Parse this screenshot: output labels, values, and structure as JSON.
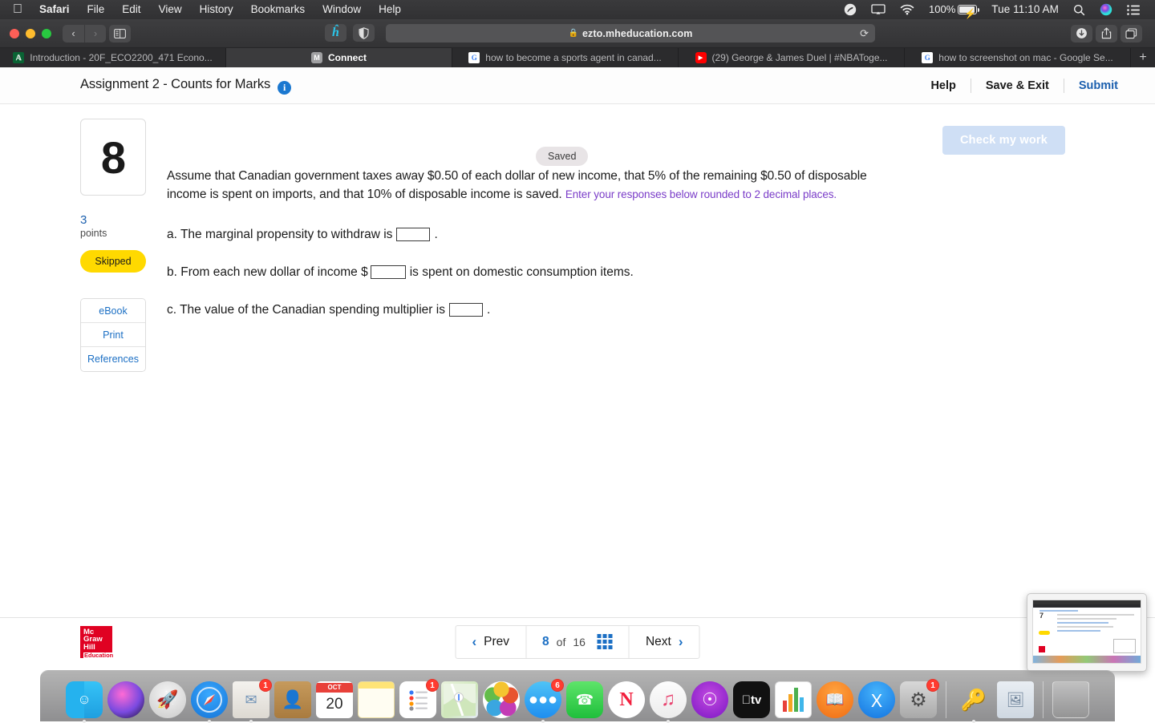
{
  "menubar": {
    "apple_icon": "apple-logo",
    "items": [
      {
        "label": "Safari",
        "bold": true
      },
      {
        "label": "File",
        "bold": false
      },
      {
        "label": "Edit",
        "bold": false
      },
      {
        "label": "View",
        "bold": false
      },
      {
        "label": "History",
        "bold": false
      },
      {
        "label": "Bookmarks",
        "bold": false
      },
      {
        "label": "Window",
        "bold": false
      },
      {
        "label": "Help",
        "bold": false
      }
    ],
    "status": {
      "shazam_icon": "shazam-icon",
      "airplay_icon": "airplay-icon",
      "wifi_icon": "wifi-icon",
      "battery_percent": "100%",
      "battery_icon": "battery-charging-icon",
      "clock": "Tue 11:10 AM",
      "search_icon": "spotlight-search-icon",
      "siri_icon": "siri-icon",
      "control_center_icon": "control-center-icon"
    }
  },
  "browser": {
    "toolbar": {
      "back_icon": "back-chevron-icon",
      "forward_icon": "forward-chevron-icon",
      "sidebar_icon": "sidebar-toggle-icon",
      "honey_icon": "honey-extension-icon",
      "privacy_icon": "privacy-report-icon",
      "downloads_icon": "downloads-icon",
      "share_icon": "share-icon",
      "tabs_icon": "tab-overview-icon"
    },
    "address": {
      "lock_icon": "lock-icon",
      "url": "ezto.mheducation.com",
      "reload_icon": "reload-icon"
    },
    "tabs": [
      {
        "favicon": "acorn-icon",
        "label": "Introduction - 20F_ECO2200_471 Econo...",
        "active": false
      },
      {
        "favicon": "mcgraw-m-icon",
        "label": "Connect",
        "active": true
      },
      {
        "favicon": "google-icon",
        "label": "how to become a sports agent in canad...",
        "active": false
      },
      {
        "favicon": "youtube-icon",
        "label": "(29) George & James Duel | #NBAToge...",
        "active": false
      },
      {
        "favicon": "google-icon",
        "label": "how to screenshot on mac - Google Se...",
        "active": false
      }
    ],
    "new_tab_label": "+"
  },
  "page": {
    "header": {
      "title": "Assignment 2 - Counts for Marks",
      "info_icon": "info-icon",
      "status_badge": "Saved",
      "actions": [
        {
          "label": "Help",
          "style": "plain"
        },
        {
          "label": "Save & Exit",
          "style": "plain"
        },
        {
          "label": "Submit",
          "style": "link"
        }
      ]
    },
    "rail": {
      "question_number": "8",
      "points_value": "3",
      "points_label": "points",
      "status_badge": "Skipped",
      "status_color": "#ffd900",
      "tools": [
        {
          "label": "eBook"
        },
        {
          "label": "Print"
        },
        {
          "label": "References"
        }
      ]
    },
    "check_my_work": "Check my work",
    "question": {
      "body": "Assume that Canadian government taxes away $0.50 of each dollar of new income, that 5% of the remaining $0.50 of disposable income is spent on imports, and that 10% of disposable income is saved.",
      "hint": "Enter your responses below rounded to 2 decimal places.",
      "hint_color": "#7a3cc8",
      "parts": [
        {
          "before": "a. The marginal propensity to withdraw is",
          "value": "",
          "after": "."
        },
        {
          "before": "b. From each new dollar of income $",
          "value": "",
          "after": "is spent on domestic consumption items."
        },
        {
          "before": "c. The value of the Canadian spending multiplier is",
          "value": "",
          "after": "."
        }
      ]
    },
    "footer": {
      "logo_lines": [
        "Mc",
        "Graw",
        "Hill"
      ],
      "logo_sub": "Education",
      "prev_label": "Prev",
      "prev_icon": "chevron-left-icon",
      "current_page": "8",
      "of_label": "of",
      "total_pages": "16",
      "grid_icon": "question-grid-icon",
      "next_label": "Next",
      "next_icon": "chevron-right-icon"
    }
  },
  "screenshot_preview": {
    "name": "screenshot-thumbnail",
    "question_number": "7"
  },
  "dock": {
    "apps": [
      {
        "name": "finder",
        "icon": "finder-icon",
        "badge": "",
        "running": true
      },
      {
        "name": "siri",
        "icon": "siri-icon",
        "badge": "",
        "running": false
      },
      {
        "name": "launchpad",
        "icon": "launchpad-icon",
        "badge": "",
        "running": false
      },
      {
        "name": "safari",
        "icon": "safari-icon",
        "badge": "",
        "running": true
      },
      {
        "name": "mail",
        "icon": "mail-icon",
        "badge": "1",
        "running": true
      },
      {
        "name": "contacts",
        "icon": "contacts-icon",
        "badge": "",
        "running": false
      },
      {
        "name": "calendar",
        "icon": "calendar-icon",
        "badge": "",
        "running": false,
        "month": "OCT",
        "day": "20"
      },
      {
        "name": "notes",
        "icon": "notes-icon",
        "badge": "",
        "running": false
      },
      {
        "name": "reminders",
        "icon": "reminders-icon",
        "badge": "1",
        "running": false
      },
      {
        "name": "maps",
        "icon": "maps-icon",
        "badge": "",
        "running": false
      },
      {
        "name": "photos",
        "icon": "photos-icon",
        "badge": "",
        "running": false
      },
      {
        "name": "messages",
        "icon": "messages-icon",
        "badge": "6",
        "running": true
      },
      {
        "name": "facetime",
        "icon": "facetime-icon",
        "badge": "",
        "running": false
      },
      {
        "name": "news",
        "icon": "news-icon",
        "badge": "",
        "running": false
      },
      {
        "name": "music",
        "icon": "music-icon",
        "badge": "",
        "running": true
      },
      {
        "name": "podcasts",
        "icon": "podcasts-icon",
        "badge": "",
        "running": false
      },
      {
        "name": "appletv",
        "icon": "appletv-icon",
        "badge": "",
        "running": false
      },
      {
        "name": "numbers",
        "icon": "numbers-icon",
        "badge": "",
        "running": false
      },
      {
        "name": "books",
        "icon": "books-icon",
        "badge": "",
        "running": false
      },
      {
        "name": "appstore",
        "icon": "app-store-icon",
        "badge": "",
        "running": false
      },
      {
        "name": "system-preferences",
        "icon": "system-preferences-icon",
        "badge": "1",
        "running": false
      },
      {
        "name": "keychain-access",
        "icon": "keychain-icon",
        "badge": "",
        "running": true
      },
      {
        "name": "preview",
        "icon": "preview-icon",
        "badge": "",
        "running": false
      },
      {
        "name": "trash",
        "icon": "trash-icon",
        "badge": "",
        "running": false
      }
    ]
  }
}
